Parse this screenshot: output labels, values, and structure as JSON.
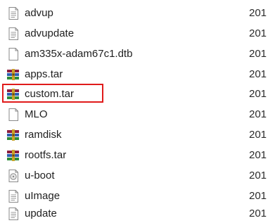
{
  "files": [
    {
      "name": "advup",
      "date": "201",
      "icon": "text-document-icon"
    },
    {
      "name": "advupdate",
      "date": "201",
      "icon": "text-document-icon"
    },
    {
      "name": "am335x-adam67c1.dtb",
      "date": "201",
      "icon": "blank-file-icon"
    },
    {
      "name": "apps.tar",
      "date": "201",
      "icon": "winrar-archive-icon"
    },
    {
      "name": "custom.tar",
      "date": "201",
      "icon": "winrar-archive-icon",
      "highlighted": true
    },
    {
      "name": "MLO",
      "date": "201",
      "icon": "blank-file-icon"
    },
    {
      "name": "ramdisk",
      "date": "201",
      "icon": "winrar-archive-icon"
    },
    {
      "name": "rootfs.tar",
      "date": "201",
      "icon": "winrar-archive-icon"
    },
    {
      "name": "u-boot",
      "date": "201",
      "icon": "disc-image-file-icon"
    },
    {
      "name": "uImage",
      "date": "201",
      "icon": "text-document-icon"
    },
    {
      "name": "update",
      "date": "201",
      "icon": "text-document-icon"
    }
  ],
  "highlight_color": "#e01b1b"
}
